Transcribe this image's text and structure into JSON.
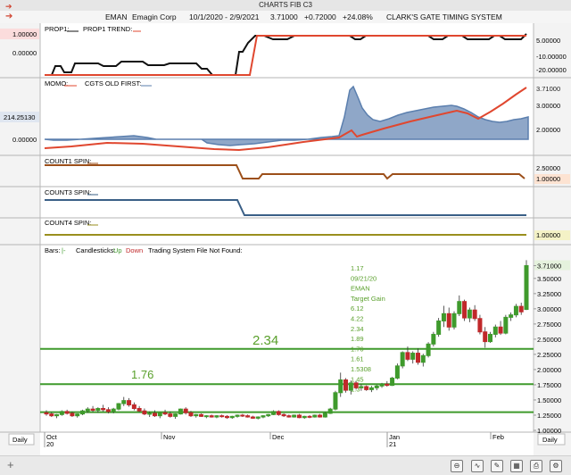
{
  "window": {
    "title": "CHARTS FIB C3"
  },
  "header": {
    "symbol": "EMAN",
    "company": "Emagin Corp",
    "date_range": "10/1/2020 - 2/9/2021",
    "last": "3.71000",
    "change": "+0.72000",
    "pct_change": "+24.08%",
    "system": "CLARK'S GATE TIMING SYSTEM"
  },
  "colors": {
    "red": "#e0472f",
    "black": "#111111",
    "blue": "#5b7fae",
    "blue_fill": "#8fa7c8",
    "brown": "#9c4f19",
    "navy": "#3a5f86",
    "olive": "#9a8f1e",
    "green": "#3f9a2c",
    "candle_red": "#c0282a",
    "fib_green": "#5aa02c"
  },
  "panels": {
    "prop": {
      "legend": [
        "PROP1:",
        "PROP1 TREND:"
      ],
      "left_values": [
        "1.00000",
        "0.00000"
      ],
      "right_ticks": [
        "5.00000",
        "-10.00000",
        "-20.00000"
      ]
    },
    "momo": {
      "legend": [
        "MOMO:",
        "CGTS OLD FIRST:"
      ],
      "left_values": [
        "214.25130",
        "0.00000"
      ],
      "right_ticks": [
        "3.71000",
        "3.00000",
        "2.00000"
      ]
    },
    "count1": {
      "legend": "COUNT1 SPIN:",
      "right_ticks": [
        "2.50000",
        "1.00000"
      ]
    },
    "count3": {
      "legend": "COUNT3 SPIN:"
    },
    "count4": {
      "legend": "COUNT4 SPIN:",
      "right_ticks": [
        "1.00000"
      ]
    },
    "price": {
      "legend": {
        "bars": "Bars:",
        "bars_suffix": "|-",
        "candles": "Candlesticks:",
        "up": "Up",
        "down": "Down",
        "system": "Trading System File Not Found:"
      },
      "right_ticks": [
        "3.71000",
        "3.50000",
        "3.25000",
        "3.00000",
        "2.75000",
        "2.50000",
        "2.25000",
        "2.00000",
        "1.75000",
        "1.50000",
        "1.25000",
        "1.00000"
      ],
      "fib_labels": [
        "2.34",
        "1.76"
      ],
      "fib_list": [
        "1.17",
        "09/21/20",
        "EMAN",
        "Target Gain",
        "6.12",
        "4.22",
        "2.34",
        "1.89",
        "1.76",
        "1.61",
        "1.5308",
        "1.45",
        "1.3"
      ]
    }
  },
  "x_axis": {
    "labels": [
      "Oct",
      "20",
      "Nov",
      "Dec",
      "Jan",
      "21",
      "Feb"
    ]
  },
  "bottom": {
    "left_label": "Daily",
    "right_label": "Daily"
  },
  "chart_data": {
    "type": "candlestick",
    "title": "EMAN Emagin Corp",
    "x_range": [
      "10/1/2020",
      "2/9/2021"
    ],
    "ylim": [
      1.0,
      3.85
    ],
    "fib_levels": [
      2.34,
      1.76,
      1.3
    ],
    "candles": [
      [
        1.29,
        1.33,
        1.24,
        1.27
      ],
      [
        1.27,
        1.3,
        1.22,
        1.24
      ],
      [
        1.24,
        1.27,
        1.2,
        1.26
      ],
      [
        1.26,
        1.33,
        1.24,
        1.31
      ],
      [
        1.31,
        1.34,
        1.26,
        1.28
      ],
      [
        1.28,
        1.31,
        1.22,
        1.24
      ],
      [
        1.24,
        1.28,
        1.21,
        1.27
      ],
      [
        1.27,
        1.34,
        1.25,
        1.32
      ],
      [
        1.32,
        1.38,
        1.29,
        1.35
      ],
      [
        1.35,
        1.4,
        1.3,
        1.33
      ],
      [
        1.33,
        1.38,
        1.29,
        1.36
      ],
      [
        1.36,
        1.42,
        1.31,
        1.34
      ],
      [
        1.34,
        1.38,
        1.28,
        1.31
      ],
      [
        1.31,
        1.37,
        1.28,
        1.35
      ],
      [
        1.35,
        1.45,
        1.33,
        1.44
      ],
      [
        1.44,
        1.55,
        1.4,
        1.49
      ],
      [
        1.49,
        1.53,
        1.39,
        1.42
      ],
      [
        1.42,
        1.46,
        1.33,
        1.36
      ],
      [
        1.36,
        1.4,
        1.3,
        1.32
      ],
      [
        1.32,
        1.36,
        1.25,
        1.27
      ],
      [
        1.27,
        1.31,
        1.22,
        1.28
      ],
      [
        1.28,
        1.33,
        1.22,
        1.24
      ],
      [
        1.24,
        1.3,
        1.2,
        1.29
      ],
      [
        1.29,
        1.34,
        1.25,
        1.27
      ],
      [
        1.27,
        1.31,
        1.21,
        1.23
      ],
      [
        1.23,
        1.28,
        1.19,
        1.27
      ],
      [
        1.27,
        1.36,
        1.26,
        1.35
      ],
      [
        1.35,
        1.38,
        1.26,
        1.29
      ],
      [
        1.29,
        1.32,
        1.22,
        1.24
      ],
      [
        1.24,
        1.27,
        1.21,
        1.26
      ],
      [
        1.26,
        1.28,
        1.22,
        1.23
      ],
      [
        1.23,
        1.25,
        1.2,
        1.24
      ],
      [
        1.24,
        1.26,
        1.21,
        1.22
      ],
      [
        1.22,
        1.25,
        1.2,
        1.24
      ],
      [
        1.24,
        1.26,
        1.21,
        1.23
      ],
      [
        1.23,
        1.25,
        1.19,
        1.21
      ],
      [
        1.21,
        1.24,
        1.19,
        1.23
      ],
      [
        1.23,
        1.26,
        1.21,
        1.25
      ],
      [
        1.25,
        1.27,
        1.22,
        1.24
      ],
      [
        1.24,
        1.26,
        1.21,
        1.22
      ],
      [
        1.22,
        1.24,
        1.19,
        1.2
      ],
      [
        1.2,
        1.23,
        1.18,
        1.22
      ],
      [
        1.22,
        1.25,
        1.2,
        1.24
      ],
      [
        1.24,
        1.27,
        1.22,
        1.26
      ],
      [
        1.26,
        1.33,
        1.25,
        1.31
      ],
      [
        1.31,
        1.33,
        1.24,
        1.26
      ],
      [
        1.26,
        1.28,
        1.22,
        1.24
      ],
      [
        1.24,
        1.26,
        1.21,
        1.22
      ],
      [
        1.22,
        1.26,
        1.21,
        1.25
      ],
      [
        1.25,
        1.27,
        1.2,
        1.21
      ],
      [
        1.21,
        1.24,
        1.19,
        1.23
      ],
      [
        1.23,
        1.25,
        1.2,
        1.22
      ],
      [
        1.22,
        1.26,
        1.21,
        1.25
      ],
      [
        1.25,
        1.27,
        1.21,
        1.22
      ],
      [
        1.22,
        1.3,
        1.21,
        1.28
      ],
      [
        1.28,
        1.37,
        1.27,
        1.35
      ],
      [
        1.35,
        1.65,
        1.33,
        1.62
      ],
      [
        1.62,
        1.95,
        1.55,
        1.83
      ],
      [
        1.83,
        1.86,
        1.62,
        1.66
      ],
      [
        1.66,
        1.82,
        1.59,
        1.78
      ],
      [
        1.78,
        1.81,
        1.67,
        1.7
      ],
      [
        1.7,
        1.76,
        1.65,
        1.72
      ],
      [
        1.72,
        1.74,
        1.65,
        1.67
      ],
      [
        1.67,
        1.73,
        1.63,
        1.7
      ],
      [
        1.7,
        1.75,
        1.66,
        1.73
      ],
      [
        1.73,
        1.78,
        1.7,
        1.76
      ],
      [
        1.76,
        1.81,
        1.72,
        1.74
      ],
      [
        1.74,
        1.88,
        1.73,
        1.86
      ],
      [
        1.86,
        2.1,
        1.84,
        2.06
      ],
      [
        2.06,
        2.3,
        2.02,
        2.28
      ],
      [
        2.28,
        2.38,
        2.14,
        2.17
      ],
      [
        2.17,
        2.3,
        2.1,
        2.27
      ],
      [
        2.27,
        2.35,
        2.08,
        2.12
      ],
      [
        2.12,
        2.26,
        2.05,
        2.23
      ],
      [
        2.23,
        2.45,
        2.2,
        2.42
      ],
      [
        2.42,
        2.62,
        2.38,
        2.58
      ],
      [
        2.58,
        2.85,
        2.54,
        2.8
      ],
      [
        2.8,
        3.05,
        2.7,
        2.92
      ],
      [
        2.92,
        3.02,
        2.64,
        2.7
      ],
      [
        2.7,
        2.96,
        2.66,
        2.92
      ],
      [
        2.92,
        3.22,
        2.88,
        3.12
      ],
      [
        3.12,
        3.15,
        2.8,
        2.85
      ],
      [
        2.85,
        3.02,
        2.78,
        2.98
      ],
      [
        2.98,
        3.06,
        2.8,
        2.84
      ],
      [
        2.84,
        2.9,
        2.58,
        2.62
      ],
      [
        2.62,
        2.7,
        2.36,
        2.46
      ],
      [
        2.46,
        2.62,
        2.44,
        2.58
      ],
      [
        2.58,
        2.74,
        2.53,
        2.7
      ],
      [
        2.7,
        2.8,
        2.57,
        2.6
      ],
      [
        2.6,
        2.9,
        2.58,
        2.86
      ],
      [
        2.86,
        2.94,
        2.8,
        2.9
      ],
      [
        2.9,
        3.08,
        2.86,
        3.04
      ],
      [
        3.04,
        3.1,
        2.9,
        2.95
      ],
      [
        2.99,
        3.8,
        2.98,
        3.71
      ]
    ],
    "prop_series": {
      "prop1": [],
      "prop1_trend": []
    },
    "momo_series": {
      "momo": [],
      "cgts_old_first": []
    }
  }
}
